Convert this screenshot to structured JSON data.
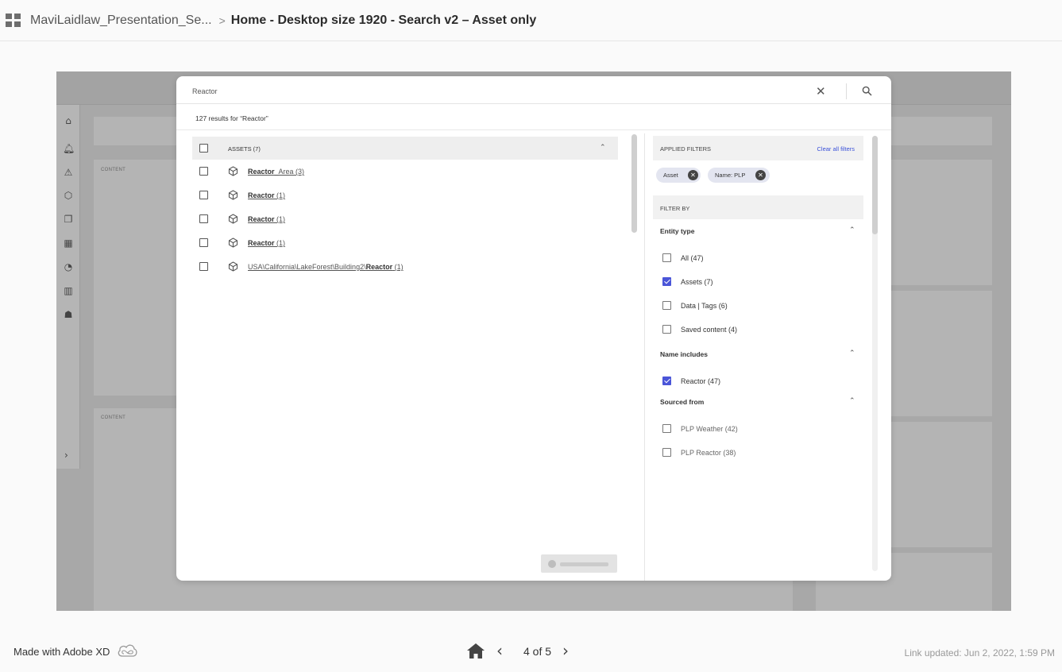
{
  "breadcrumb": {
    "project": "MaviLaidlaw_Presentation_Se...",
    "separator": ">",
    "page": "Home - Desktop size 1920 - Search v2 – Asset only"
  },
  "background": {
    "content_label_1": "CONTENT",
    "content_label_2": "CONTENT",
    "rail_icons": [
      "home-icon",
      "bell-icon",
      "warning-icon",
      "cube-icon",
      "copy-icon",
      "dashboard-icon",
      "gauge-icon",
      "bar-chart-icon",
      "user-group-icon"
    ],
    "rail_expand": "›"
  },
  "search": {
    "value": "Reactor",
    "results_count": "127 results for “Reactor”",
    "close_glyph": "✕"
  },
  "list": {
    "group_title": "ASSETS (7)",
    "rows": [
      {
        "prefix": "",
        "bold": "Reactor",
        "suffix": "_Area (3)"
      },
      {
        "prefix": "",
        "bold": "Reactor",
        "suffix": " (1)"
      },
      {
        "prefix": "",
        "bold": "Reactor",
        "suffix": " (1)"
      },
      {
        "prefix": "",
        "bold": "Reactor",
        "suffix": " (1)"
      },
      {
        "prefix": "USA\\California\\LakeForest\\Building2\\",
        "bold": "Reactor",
        "suffix": " (1)"
      }
    ]
  },
  "filters": {
    "applied_title": "APPLIED FILTERS",
    "clear_all": "Clear all filters",
    "chips": [
      "Asset",
      "Name: PLP"
    ],
    "filter_by_title": "FILTER BY",
    "entity_type": {
      "title": "Entity type",
      "options": [
        {
          "label": "All (47)",
          "checked": false
        },
        {
          "label": "Assets (7)",
          "checked": true
        },
        {
          "label": "Data | Tags (6)",
          "checked": false
        },
        {
          "label": "Saved content (4)",
          "checked": false
        }
      ]
    },
    "name_includes": {
      "title": "Name includes",
      "options": [
        {
          "label": "Reactor (47)",
          "checked": true
        }
      ]
    },
    "sourced_from": {
      "title": "Sourced from",
      "options": [
        {
          "label": "PLP Weather (42)",
          "checked": false
        },
        {
          "label": "PLP Reactor (38)",
          "checked": false
        }
      ]
    }
  },
  "footer": {
    "made_with": "Made with Adobe XD",
    "page_indicator": "4 of 5",
    "prev": "‹",
    "next": "›",
    "link_updated": "Link updated: Jun 2, 2022, 1:59 PM"
  },
  "colors": {
    "accent": "#4a55d8",
    "link": "#3b52d9"
  }
}
